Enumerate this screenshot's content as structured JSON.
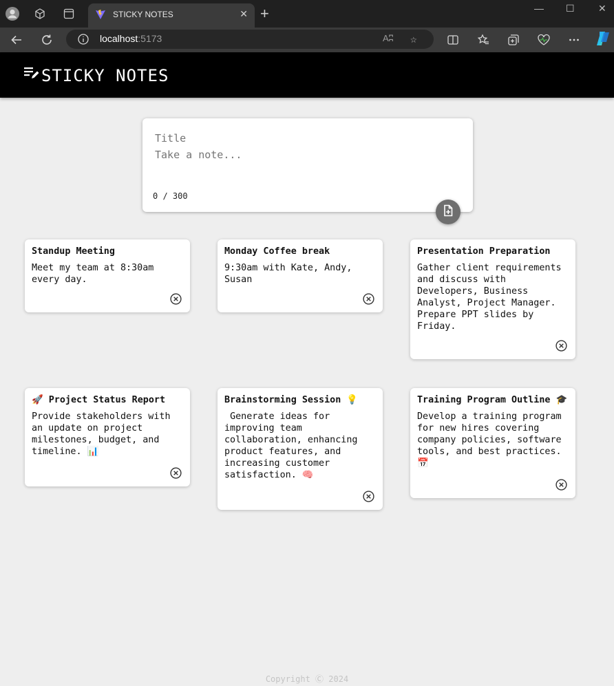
{
  "browser": {
    "tab_title": "STICKY NOTES",
    "tab_close": "✕",
    "new_tab": "+",
    "url_host": "localhost",
    "url_port": ":5173",
    "read_aloud": "Aʭ",
    "window_controls": {
      "minimize": "—",
      "maximize": "☐",
      "close": "✕"
    }
  },
  "header": {
    "title": "STICKY NOTES",
    "background": "#000000"
  },
  "composer": {
    "title_placeholder": "Title",
    "body_placeholder": "Take a note...",
    "counter": "0 / 300"
  },
  "notes": [
    {
      "title": "Standup Meeting",
      "body": "Meet my team at 8:30am\nevery day."
    },
    {
      "title": "Monday Coffee break",
      "body": "9:30am with Kate, Andy,\nSusan"
    },
    {
      "title": "Presentation Preparation",
      "body": "Gather client requirements\nand discuss with\nDevelopers, Business\nAnalyst, Project Manager.\nPrepare PPT slides by\nFriday."
    },
    {
      "title": "🚀 Project Status Report",
      "body": "Provide stakeholders with\nan update on project\nmilestones, budget, and\ntimeline. 📊"
    },
    {
      "title": "Brainstorming Session 💡",
      "body": " Generate ideas for\nimproving team\ncollaboration, enhancing\nproduct features, and\nincreasing customer\nsatisfaction. 🧠"
    },
    {
      "title": "Training Program Outline 🎓",
      "body": "Develop a training program\nfor new hires covering\ncompany policies, software\ntools, and best practices.\n📅"
    }
  ],
  "footer": {
    "text": "Copyright Ⓒ 2024"
  }
}
